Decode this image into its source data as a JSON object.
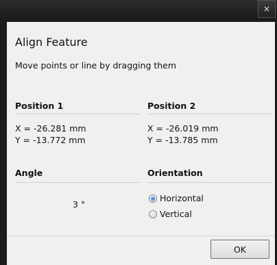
{
  "window": {
    "close_glyph": "×",
    "title": "Align Feature",
    "subtitle": "Move points or line by dragging them"
  },
  "position1": {
    "heading": "Position 1",
    "x": "X = -26.281 mm",
    "y": "Y = -13.772 mm"
  },
  "position2": {
    "heading": "Position 2",
    "x": "X = -26.019 mm",
    "y": "Y = -13.785 mm"
  },
  "angle": {
    "heading": "Angle",
    "value": "3 °"
  },
  "orientation": {
    "heading": "Orientation",
    "options": [
      {
        "label": "Horizontal",
        "selected": true
      },
      {
        "label": "Vertical",
        "selected": false
      }
    ]
  },
  "buttons": {
    "ok": "OK"
  }
}
